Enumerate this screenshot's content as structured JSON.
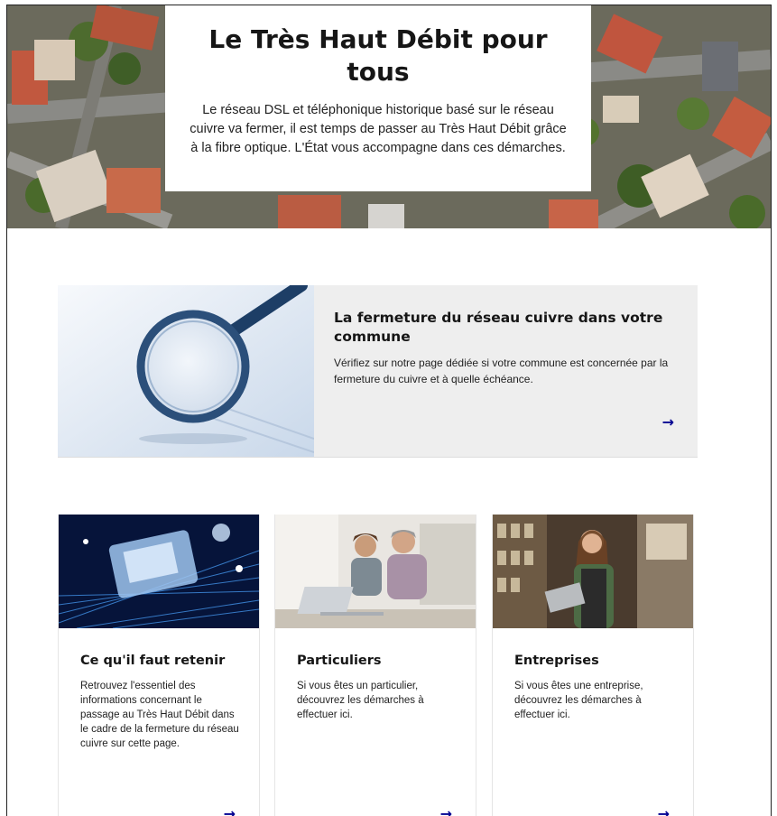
{
  "hero": {
    "title": "Le Très Haut Débit pour tous",
    "text": "Le réseau DSL et téléphonique historique basé sur le réseau cuivre va fermer, il est temps de passer au Très Haut Débit grâce à la fibre optique. L'État vous accompagne dans ces démarches."
  },
  "feature": {
    "title": "La fermeture du réseau cuivre dans votre commune",
    "description": "Vérifiez sur notre page dédiée si votre commune est concernée par la fermeture du cuivre et à quelle échéance.",
    "arrow": "→"
  },
  "cards": [
    {
      "title": "Ce qu'il faut retenir",
      "description": "Retrouvez l'essentiel des informations concernant le passage au Très Haut Débit dans le cadre de la fermeture du réseau cuivre sur cette page.",
      "arrow": "→"
    },
    {
      "title": "Particuliers",
      "description": "Si vous êtes un particulier, découvrez les démarches à effectuer ici.",
      "arrow": "→"
    },
    {
      "title": "Entreprises",
      "description": "Si vous êtes une entreprise, découvrez les démarches à effectuer ici.",
      "arrow": "→"
    }
  ],
  "colors": {
    "accent": "#000091",
    "feature_bg": "#eeeeee"
  }
}
